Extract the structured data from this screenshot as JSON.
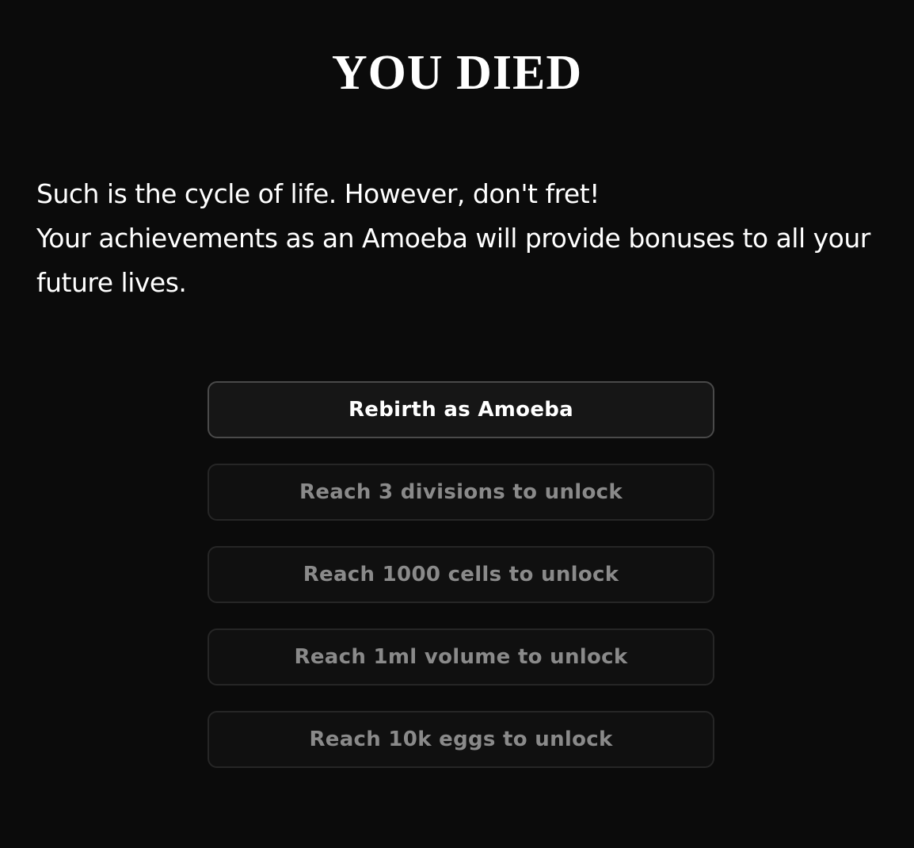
{
  "title": "YOU DIED",
  "message": {
    "line1": "Such is the cycle of life. However, don't fret!",
    "line2": "Your achievements as an Amoeba will provide bonuses to all your future lives."
  },
  "options": [
    {
      "label": "Rebirth as Amoeba",
      "state": "enabled"
    },
    {
      "label": "Reach 3 divisions to unlock",
      "state": "locked"
    },
    {
      "label": "Reach 1000 cells to unlock",
      "state": "locked"
    },
    {
      "label": "Reach 1ml volume to unlock",
      "state": "locked"
    },
    {
      "label": "Reach 10k eggs to unlock",
      "state": "locked"
    }
  ],
  "colors": {
    "background": "#0b0b0b",
    "text": "#ffffff",
    "locked_text": "#8a8a8a",
    "active_border": "#4a4a4a",
    "locked_border": "#262626"
  }
}
